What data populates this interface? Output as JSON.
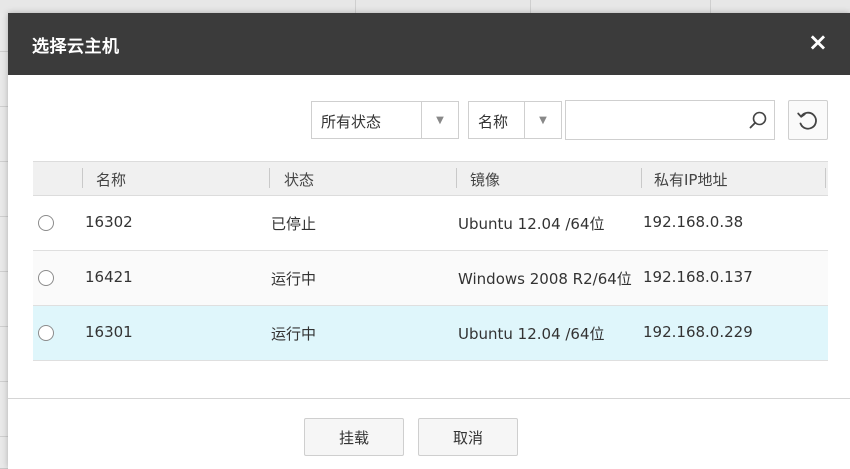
{
  "dialog": {
    "title": "选择云主机",
    "close_label": "×"
  },
  "filters": {
    "status_select": {
      "selected": "所有状态"
    },
    "field_select": {
      "selected": "名称"
    },
    "search": {
      "value": "",
      "placeholder": ""
    }
  },
  "table": {
    "columns": [
      "名称",
      "状态",
      "镜像",
      "私有IP地址"
    ],
    "rows": [
      {
        "name": "16302",
        "status": "已停止",
        "image": "Ubuntu 12.04 /64位",
        "ip": "192.168.0.38",
        "selected": false
      },
      {
        "name": "16421",
        "status": "运行中",
        "image": "Windows 2008 R2/64位",
        "ip": "192.168.0.137",
        "selected": false
      },
      {
        "name": "16301",
        "status": "运行中",
        "image": "Ubuntu 12.04 /64位",
        "ip": "192.168.0.229",
        "selected": false
      }
    ]
  },
  "footer": {
    "mount_label": "挂载",
    "cancel_label": "取消"
  },
  "icons": {
    "search": "search-icon",
    "refresh": "refresh-icon",
    "dropdown": "chevron-down-icon",
    "close": "close-icon"
  }
}
